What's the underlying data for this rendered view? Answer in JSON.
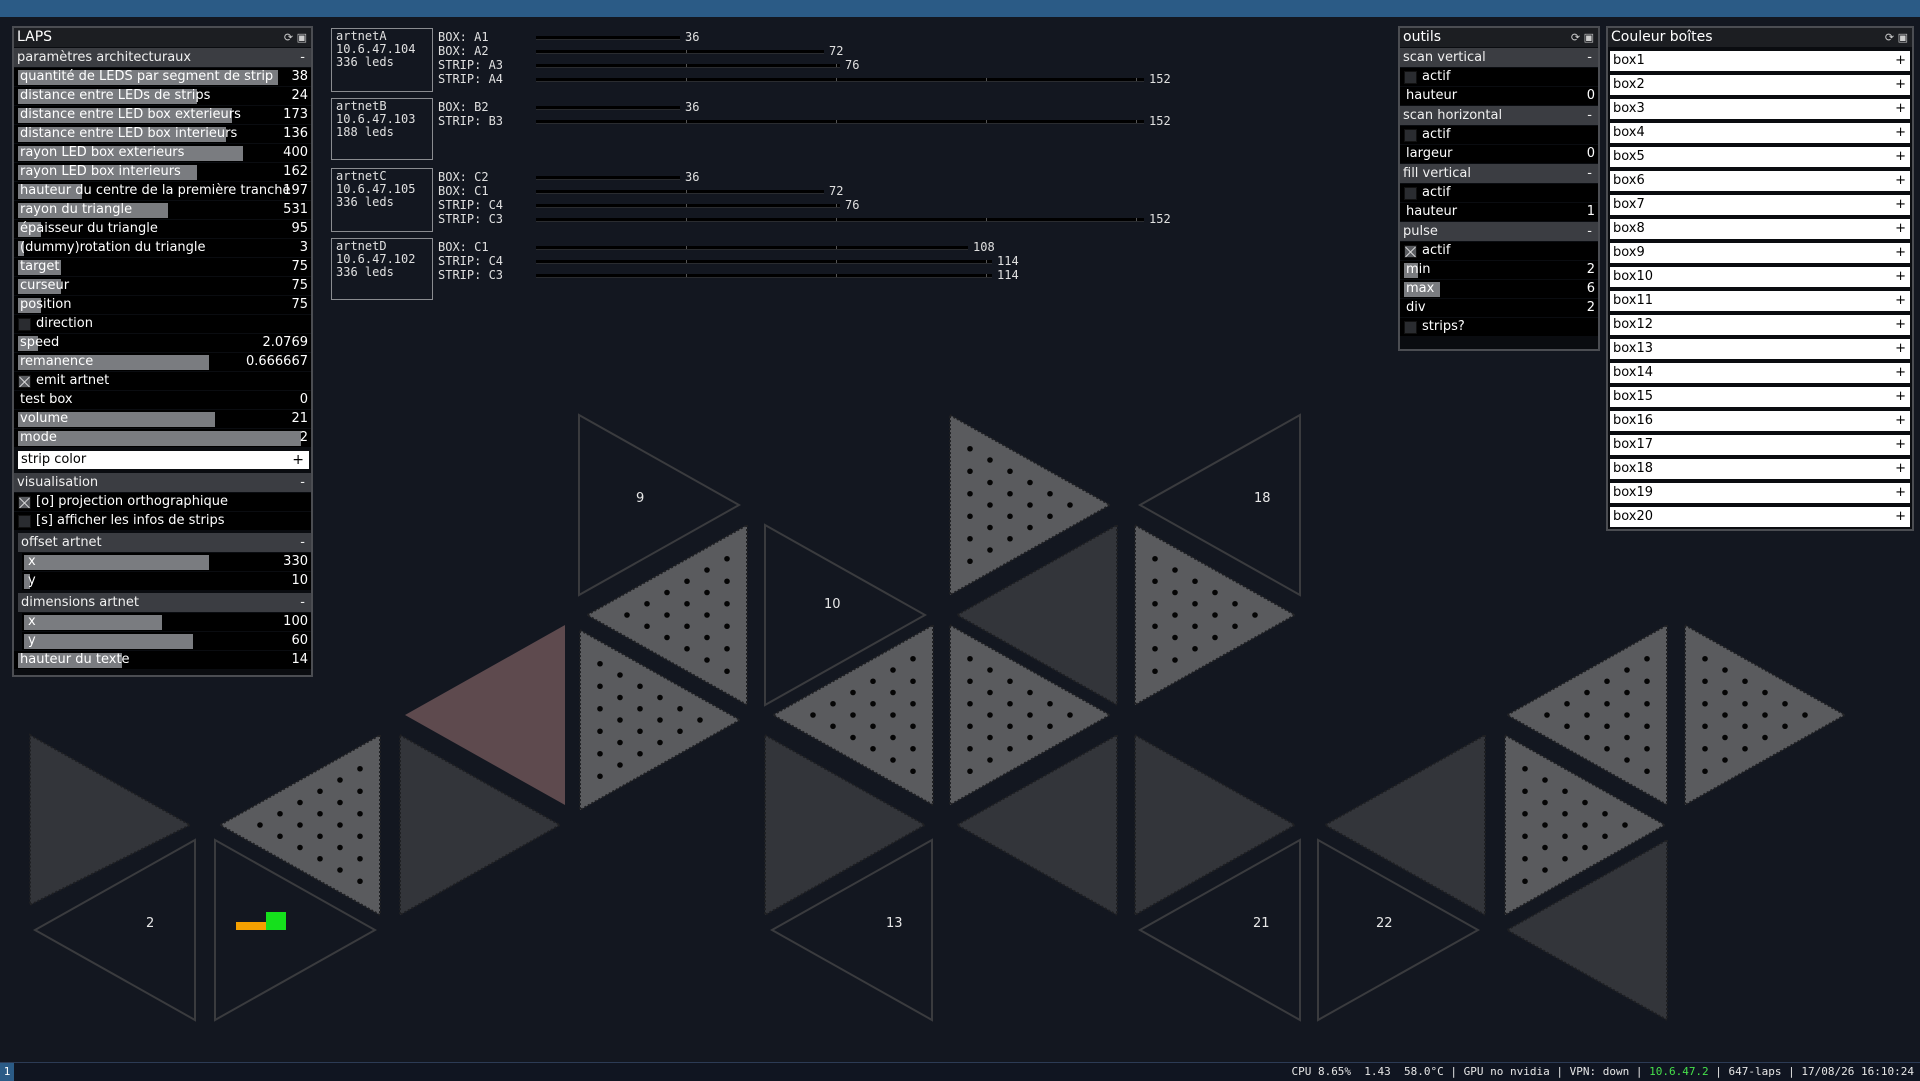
{
  "laps": {
    "title": "LAPS",
    "groups": {
      "arch": "paramètres architecturaux",
      "visu": "visualisation",
      "offset": "offset artnet",
      "dims": "dimensions artnet"
    },
    "collapse": "-",
    "params": [
      {
        "label": "quantité de LEDS par segment de strip",
        "value": "38",
        "fill": 0.9
      },
      {
        "label": "distance entre LEDs de strips",
        "value": "24",
        "fill": 0.62
      },
      {
        "label": "distance entre LED box exterieurs",
        "value": "173",
        "fill": 0.74
      },
      {
        "label": "distance entre LED box interieurs",
        "value": "136",
        "fill": 0.72
      },
      {
        "label": "rayon LED box exterieurs",
        "value": "400",
        "fill": 0.78
      },
      {
        "label": "rayon LED box interieurs",
        "value": "162",
        "fill": 0.62
      },
      {
        "label": "hauteur du centre de la première tranche",
        "value": "197",
        "fill": 0.22
      },
      {
        "label": "rayon du triangle",
        "value": "531",
        "fill": 0.52
      },
      {
        "label": "épaisseur du triangle",
        "value": "95",
        "fill": 0.08
      },
      {
        "label": "(dummy)rotation du triangle",
        "value": "3",
        "fill": 0.02
      },
      {
        "label": "target",
        "value": "75",
        "fill": 0.15
      },
      {
        "label": "curseur",
        "value": "75",
        "fill": 0.15
      },
      {
        "label": "position",
        "value": "75",
        "fill": 0.08
      }
    ],
    "direction": {
      "label": "direction",
      "checked": false
    },
    "speed": {
      "label": "speed",
      "value": "2.0769",
      "fill": 0.07
    },
    "remanence": {
      "label": "remanence",
      "value": "0.666667",
      "fill": 0.66
    },
    "emit": {
      "label": "emit artnet",
      "checked": true
    },
    "testbox": {
      "label": "test box",
      "value": "0"
    },
    "volume": {
      "label": "volume",
      "value": "21",
      "fill": 0.68
    },
    "mode": {
      "label": "mode",
      "value": "2",
      "fill": 0.98
    },
    "strip_color": {
      "label": "strip color",
      "plus": "+"
    },
    "proj": {
      "label": "[o] projection orthographique",
      "checked": true
    },
    "infos": {
      "label": "[s] afficher les infos de strips",
      "checked": false
    },
    "offset_x": {
      "label": "x",
      "value": "330",
      "fill": 0.66
    },
    "offset_y": {
      "label": "y",
      "value": "10",
      "fill": 0.02
    },
    "dim_x": {
      "label": "x",
      "value": "100",
      "fill": 0.49
    },
    "dim_y": {
      "label": "y",
      "value": "60",
      "fill": 0.6
    },
    "text_h": {
      "label": "hauteur du texte",
      "value": "14",
      "fill": 0.36
    }
  },
  "artnet": [
    {
      "name": "artnetA",
      "ip": "10.6.47.104",
      "leds": "336 leds",
      "items": [
        {
          "t": "BOX: A1",
          "v": 36
        },
        {
          "t": "BOX: A2",
          "v": 72
        },
        {
          "t": "STRIP: A3",
          "v": 76
        },
        {
          "t": "STRIP: A4",
          "v": 152
        }
      ]
    },
    {
      "name": "artnetB",
      "ip": "10.6.47.103",
      "leds": "188 leds",
      "items": [
        {
          "t": "BOX: B2",
          "v": 36
        },
        {
          "t": "STRIP: B3",
          "v": 152
        }
      ]
    },
    {
      "name": "artnetC",
      "ip": "10.6.47.105",
      "leds": "336 leds",
      "items": [
        {
          "t": "BOX: C2",
          "v": 36
        },
        {
          "t": "BOX: C1",
          "v": 72
        },
        {
          "t": "STRIP: C4",
          "v": 76
        },
        {
          "t": "STRIP: C3",
          "v": 152
        }
      ]
    },
    {
      "name": "artnetD",
      "ip": "10.6.47.102",
      "leds": "336 leds",
      "items": [
        {
          "t": "BOX: C1",
          "v": 108
        },
        {
          "t": "STRIP: C4",
          "v": 114
        },
        {
          "t": "STRIP: C3",
          "v": 114
        }
      ]
    }
  ],
  "outils": {
    "title": "outils",
    "scan_v": {
      "title": "scan vertical",
      "actif": "actif",
      "param": "hauteur",
      "value": "0"
    },
    "scan_h": {
      "title": "scan horizontal",
      "actif": "actif",
      "param": "largeur",
      "value": "0"
    },
    "fill_v": {
      "title": "fill vertical",
      "actif": "actif",
      "param": "hauteur",
      "value": "1"
    },
    "pulse": {
      "title": "pulse",
      "actif": "actif",
      "min": "min",
      "min_v": "2",
      "max": "max",
      "max_v": "6",
      "div": "div",
      "div_v": "2",
      "strips": "strips?"
    }
  },
  "couleur": {
    "title": "Couleur boîtes",
    "boxes": [
      "box1",
      "box2",
      "box3",
      "box4",
      "box5",
      "box6",
      "box7",
      "box8",
      "box9",
      "box10",
      "box11",
      "box12",
      "box13",
      "box14",
      "box15",
      "box16",
      "box17",
      "box18",
      "box19",
      "box20"
    ],
    "plus": "+"
  },
  "scene_labels": [
    "9",
    "10",
    "18",
    "2",
    "13",
    "21",
    "22"
  ],
  "status": {
    "ws": "1",
    "pre": "CPU 8.65%  1.43  58.0°C | GPU no nvidia | VPN: down | ",
    "ip": "10.6.47.2",
    "post": " | 647-laps | 17/08/26 16:10:24"
  },
  "colors": {
    "accent": "#2b5b86",
    "ip_green": "#46e04b",
    "panel_bg": "#0a0c10",
    "active_triangle": "#5e4a4e",
    "cursor_green": "#15e01c",
    "cursor_orange": "#f5a000"
  }
}
